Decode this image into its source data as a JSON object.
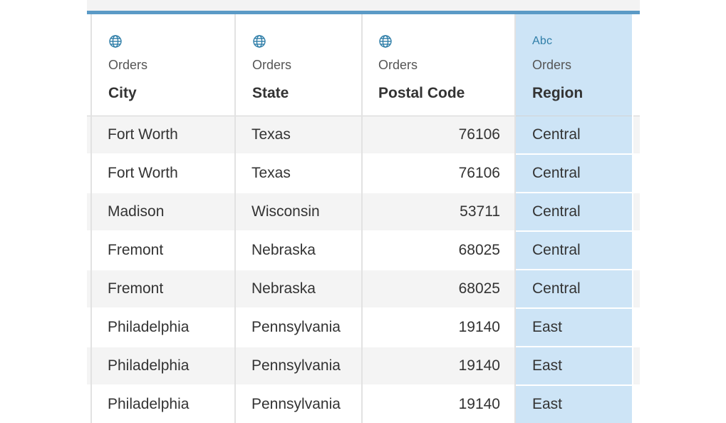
{
  "columns": [
    {
      "type_icon": "globe-icon",
      "source": "Orders",
      "field": "City"
    },
    {
      "type_icon": "globe-icon",
      "source": "Orders",
      "field": "State"
    },
    {
      "type_icon": "globe-icon",
      "source": "Orders",
      "field": "Postal Code"
    },
    {
      "type_label": "Abc",
      "source": "Orders",
      "field": "Region"
    }
  ],
  "rows": [
    {
      "city": "Fort Worth",
      "state": "Texas",
      "postal_code": "76106",
      "region": "Central"
    },
    {
      "city": "Fort Worth",
      "state": "Texas",
      "postal_code": "76106",
      "region": "Central"
    },
    {
      "city": "Madison",
      "state": "Wisconsin",
      "postal_code": "53711",
      "region": "Central"
    },
    {
      "city": "Fremont",
      "state": "Nebraska",
      "postal_code": "68025",
      "region": "Central"
    },
    {
      "city": "Fremont",
      "state": "Nebraska",
      "postal_code": "68025",
      "region": "Central"
    },
    {
      "city": "Philadelphia",
      "state": "Pennsylvania",
      "postal_code": "19140",
      "region": "East"
    },
    {
      "city": "Philadelphia",
      "state": "Pennsylvania",
      "postal_code": "19140",
      "region": "East"
    },
    {
      "city": "Philadelphia",
      "state": "Pennsylvania",
      "postal_code": "19140",
      "region": "East"
    }
  ],
  "colors": {
    "accent_bar": "#5b9ac6",
    "type_icon": "#2f7ea8",
    "selected_column": "#cde4f6",
    "row_band": "#f4f4f4"
  }
}
